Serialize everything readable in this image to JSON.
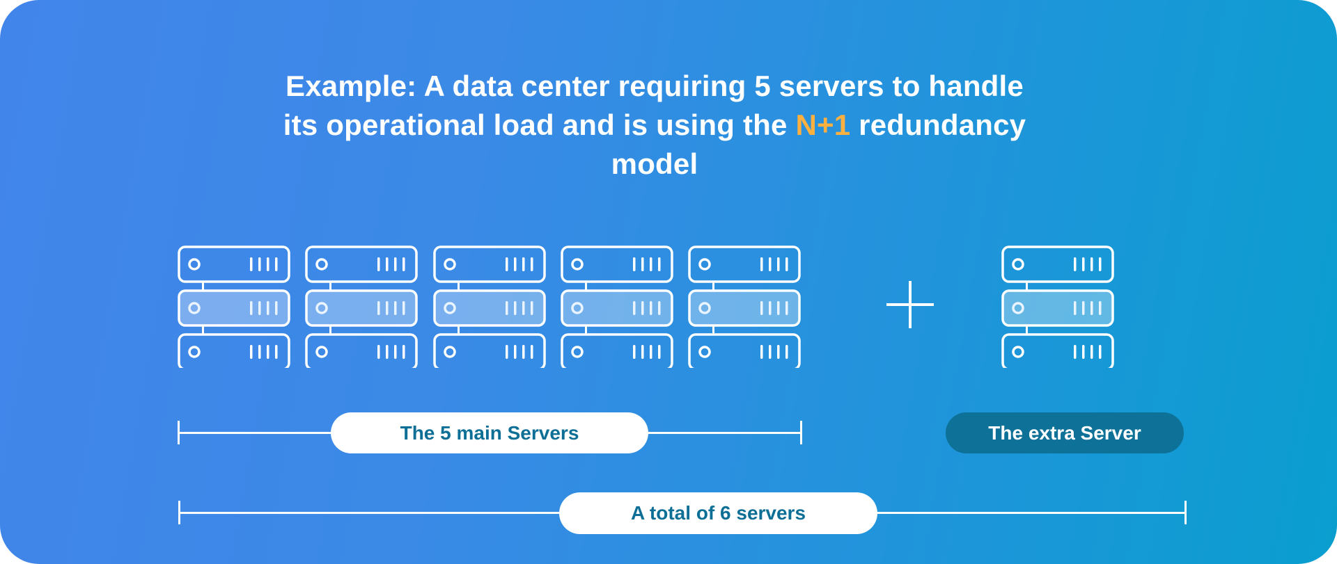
{
  "title": {
    "line1": "Example: A data center requiring 5 servers to handle",
    "line2_before": "its operational load and is using the ",
    "line2_highlight": "N+1",
    "line2_after": " redundancy",
    "line3": "model"
  },
  "colors": {
    "gradient_start": "#4285EA",
    "gradient_end": "#0A9ECF",
    "highlight": "#FBB040",
    "pill_text": "#0E6F96",
    "dark_pill": "#0E7198"
  },
  "main_servers": {
    "count": 5,
    "icon": "server-rack-icon"
  },
  "plus_icon": "plus-icon",
  "extra_server": {
    "count": 1,
    "icon": "server-rack-icon"
  },
  "labels": {
    "main": "The 5 main Servers",
    "extra": "The extra Server",
    "total": "A total of 6 servers"
  }
}
